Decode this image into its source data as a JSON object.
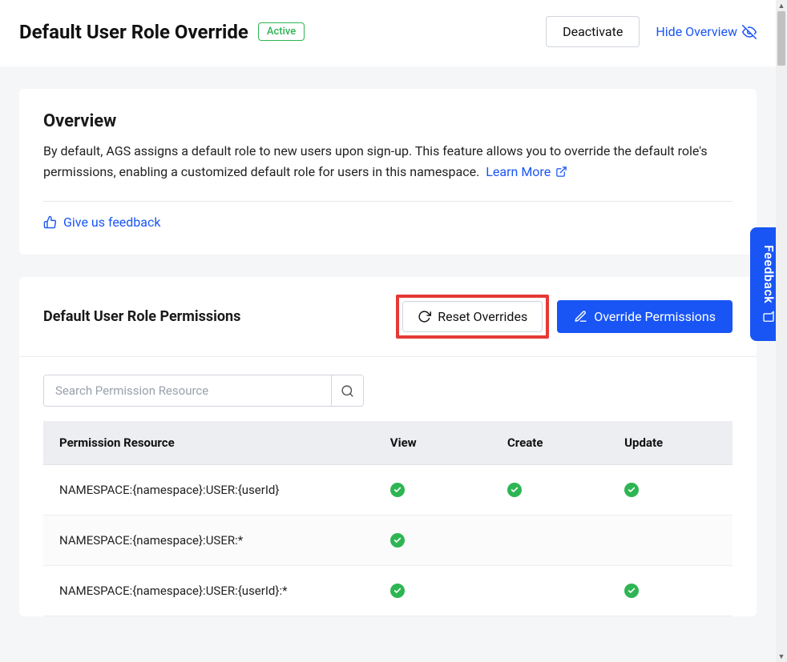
{
  "header": {
    "title": "Default User Role Override",
    "badge": "Active",
    "deactivate": "Deactivate",
    "hide_overview": "Hide Overview"
  },
  "overview": {
    "title": "Overview",
    "body": "By default, AGS assigns a default role to new users upon sign-up. This feature allows you to override the default role's permissions, enabling a customized default role for users in this namespace.",
    "learn_more": "Learn More",
    "feedback": "Give us feedback"
  },
  "permissions": {
    "title": "Default User Role Permissions",
    "reset": "Reset Overrides",
    "override": "Override Permissions",
    "search_placeholder": "Search Permission Resource",
    "columns": {
      "resource": "Permission Resource",
      "view": "View",
      "create": "Create",
      "update": "Update"
    },
    "rows": [
      {
        "resource": "NAMESPACE:{namespace}:USER:{userId}",
        "view": true,
        "create": true,
        "update": true
      },
      {
        "resource": "NAMESPACE:{namespace}:USER:*",
        "view": true,
        "create": false,
        "update": false
      },
      {
        "resource": "NAMESPACE:{namespace}:USER:{userId}:*",
        "view": true,
        "create": false,
        "update": true
      }
    ]
  },
  "side": {
    "feedback": "Feedback"
  }
}
